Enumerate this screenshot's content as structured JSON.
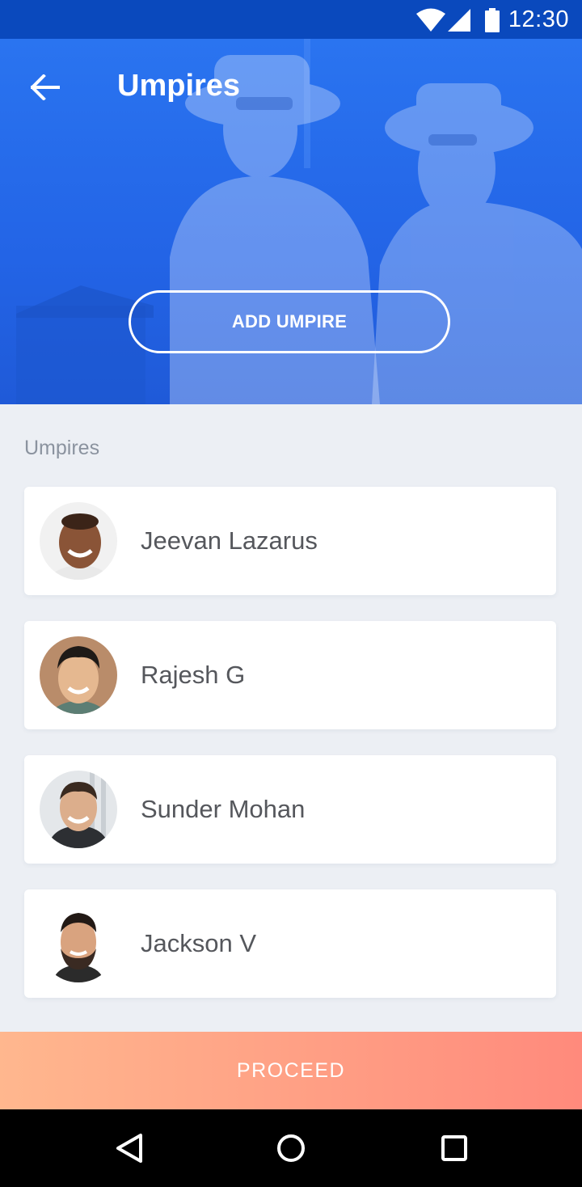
{
  "status_bar": {
    "time": "12:30",
    "icons": [
      "wifi-icon",
      "signal-icon",
      "battery-icon"
    ]
  },
  "header": {
    "title": "Umpires",
    "back_icon": "arrow-left-icon",
    "add_button_label": "ADD UMPIRE"
  },
  "section_label": "Umpires",
  "umpires": [
    {
      "name": "Jeevan Lazarus"
    },
    {
      "name": "Rajesh G"
    },
    {
      "name": "Sunder Mohan"
    },
    {
      "name": "Jackson V"
    }
  ],
  "proceed_label": "PROCEED",
  "nav_bar": {
    "icons": [
      "back-triangle-icon",
      "home-circle-icon",
      "recents-square-icon"
    ]
  },
  "colors": {
    "header_blue": "#2a74f0",
    "status_bar": "#0a49bd",
    "proceed_start": "#ffb78e",
    "proceed_end": "#ff8a7c"
  }
}
